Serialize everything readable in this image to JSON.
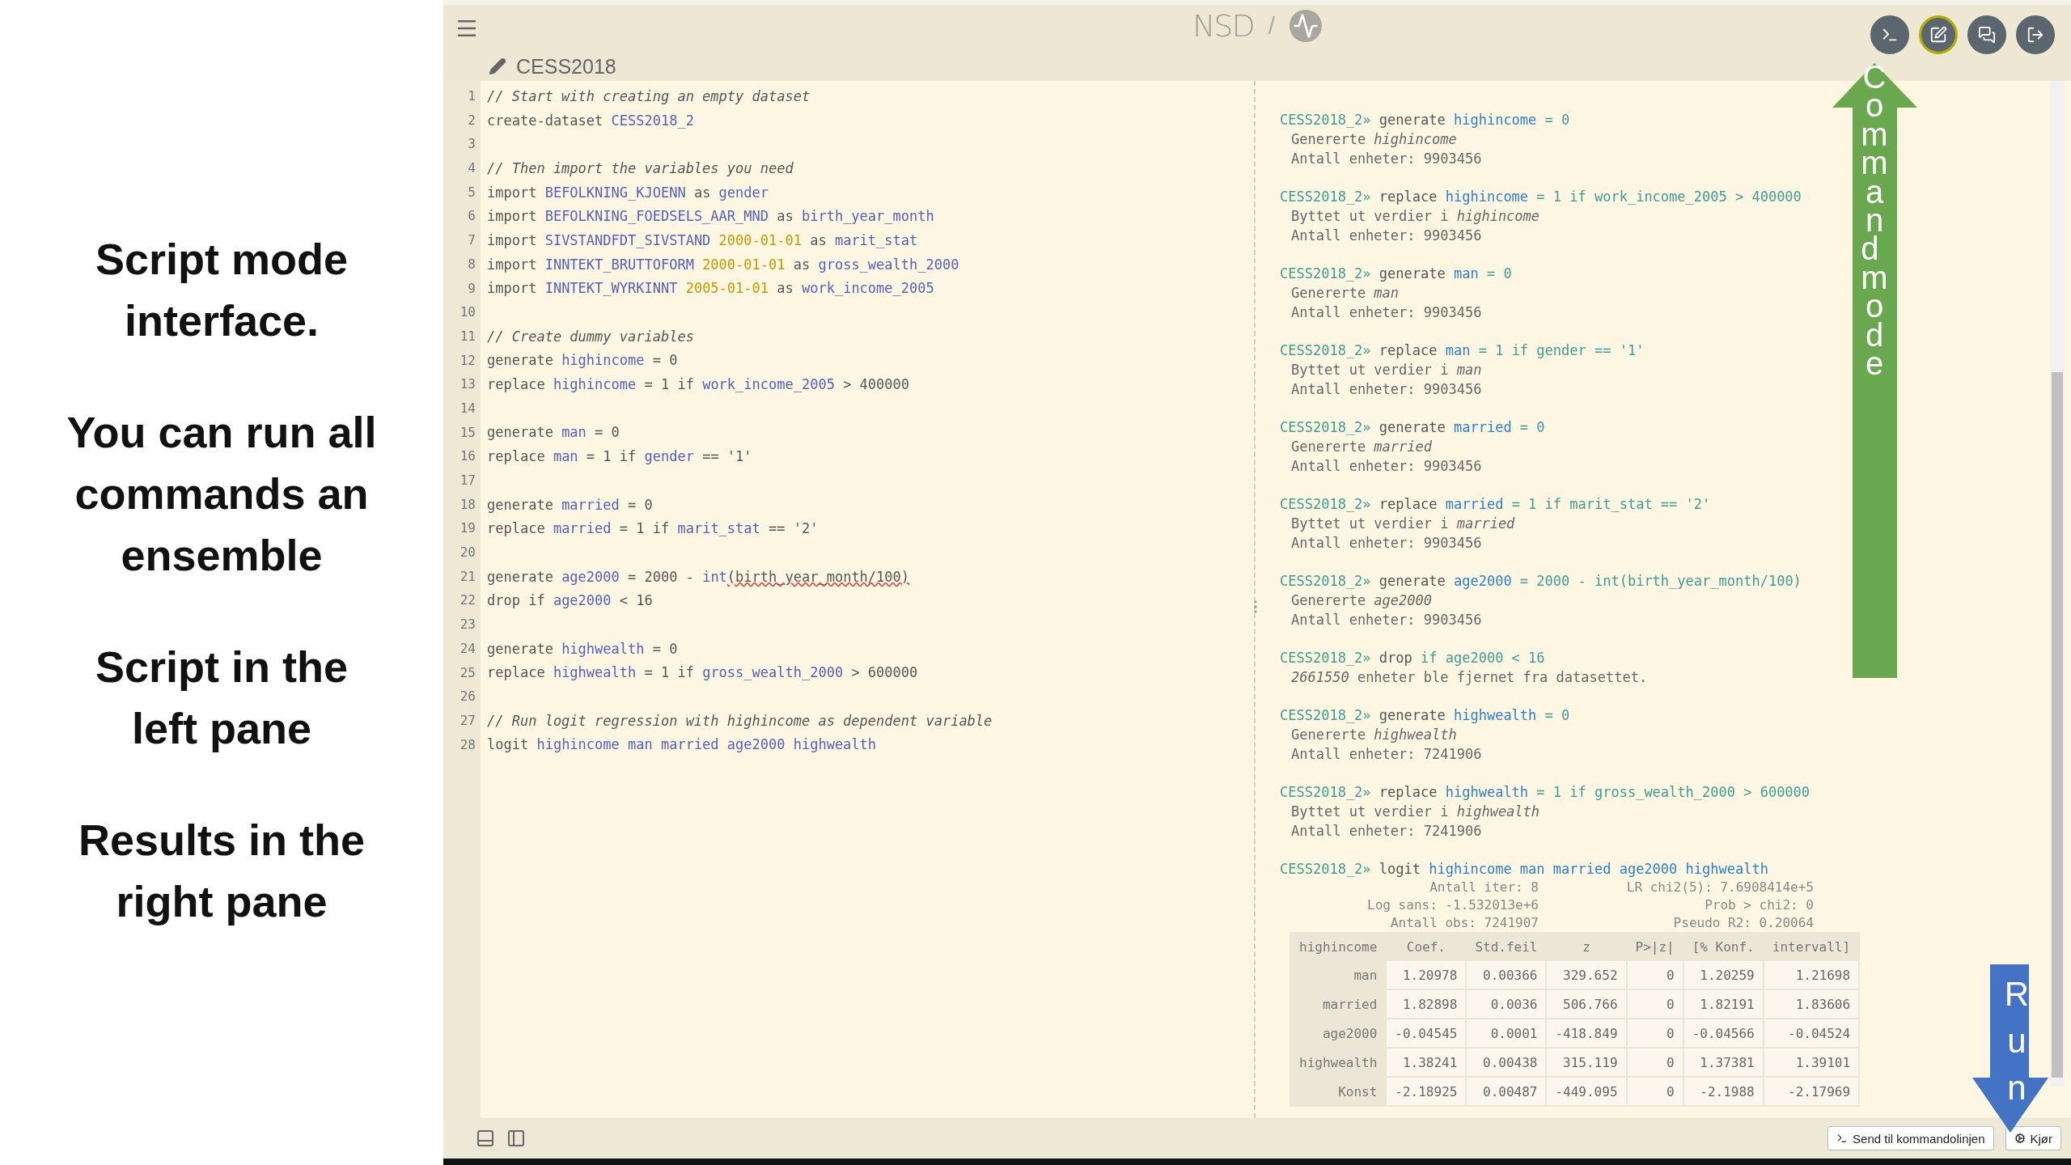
{
  "slide_captions": [
    {
      "text": "Script mode interface."
    },
    {
      "text": "You can run all commands an ensemble"
    },
    {
      "text": "Script in the left pane"
    },
    {
      "text": "Results in the right pane"
    }
  ],
  "header": {
    "logo": "NSD",
    "separator": "/",
    "mode_buttons": [
      {
        "kind": "terminal",
        "selected": false
      },
      {
        "kind": "edit",
        "selected": true
      },
      {
        "kind": "chat",
        "selected": false
      },
      {
        "kind": "logout",
        "selected": false
      }
    ]
  },
  "script_title": "CESS2018",
  "editor": {
    "lines": [
      {
        "number": "1",
        "tokens": [
          {
            "text": "// Start with creating an empty dataset",
            "kind": "comment"
          }
        ]
      },
      {
        "number": "2",
        "tokens": [
          {
            "text": "create-dataset ",
            "kind": "plain"
          },
          {
            "text": "CESS2018_2",
            "kind": "var"
          }
        ]
      },
      {
        "number": "3"
      },
      {
        "number": "4",
        "tokens": [
          {
            "text": "// Then import the variables you need",
            "kind": "comment"
          }
        ]
      },
      {
        "number": "5",
        "tokens": [
          {
            "text": "import ",
            "kind": "plain"
          },
          {
            "text": "BEFOLKNING_KJOENN",
            "kind": "var"
          },
          {
            "text": " as ",
            "kind": "plain"
          },
          {
            "text": "gender",
            "kind": "var"
          }
        ]
      },
      {
        "number": "6",
        "tokens": [
          {
            "text": "import ",
            "kind": "plain"
          },
          {
            "text": "BEFOLKNING_FOEDSELS_AAR_MND",
            "kind": "var"
          },
          {
            "text": " as ",
            "kind": "plain"
          },
          {
            "text": "birth_year_month",
            "kind": "var"
          }
        ]
      },
      {
        "number": "7",
        "tokens": [
          {
            "text": "import ",
            "kind": "plain"
          },
          {
            "text": "SIVSTANDFDT_SIVSTAND ",
            "kind": "var"
          },
          {
            "text": "2000-01-01",
            "kind": "date"
          },
          {
            "text": " as ",
            "kind": "plain"
          },
          {
            "text": "marit_stat",
            "kind": "var"
          }
        ]
      },
      {
        "number": "8",
        "tokens": [
          {
            "text": "import ",
            "kind": "plain"
          },
          {
            "text": "INNTEKT_BRUTTOFORM ",
            "kind": "var"
          },
          {
            "text": "2000-01-01",
            "kind": "date"
          },
          {
            "text": " as ",
            "kind": "plain"
          },
          {
            "text": "gross_wealth_2000",
            "kind": "var"
          }
        ]
      },
      {
        "number": "9",
        "tokens": [
          {
            "text": "import ",
            "kind": "plain"
          },
          {
            "text": "INNTEKT_WYRKINNT ",
            "kind": "var"
          },
          {
            "text": "2005-01-01",
            "kind": "date"
          },
          {
            "text": " as ",
            "kind": "plain"
          },
          {
            "text": "work_income_2005",
            "kind": "var"
          }
        ]
      },
      {
        "number": "10"
      },
      {
        "number": "11",
        "tokens": [
          {
            "text": "// Create dummy variables",
            "kind": "comment"
          }
        ]
      },
      {
        "number": "12",
        "tokens": [
          {
            "text": "generate ",
            "kind": "plain"
          },
          {
            "text": "highincome",
            "kind": "var"
          },
          {
            "text": " = 0",
            "kind": "plain"
          }
        ]
      },
      {
        "number": "13",
        "tokens": [
          {
            "text": "replace ",
            "kind": "plain"
          },
          {
            "text": "highincome",
            "kind": "var"
          },
          {
            "text": " = 1 if ",
            "kind": "plain"
          },
          {
            "text": "work_income_2005",
            "kind": "var"
          },
          {
            "text": " > 400000",
            "kind": "plain"
          }
        ]
      },
      {
        "number": "14"
      },
      {
        "number": "15",
        "tokens": [
          {
            "text": "generate ",
            "kind": "plain"
          },
          {
            "text": "man",
            "kind": "var"
          },
          {
            "text": " = 0",
            "kind": "plain"
          }
        ]
      },
      {
        "number": "16",
        "tokens": [
          {
            "text": "replace ",
            "kind": "plain"
          },
          {
            "text": "man",
            "kind": "var"
          },
          {
            "text": " = 1 if ",
            "kind": "plain"
          },
          {
            "text": "gender",
            "kind": "var"
          },
          {
            "text": " == '1'",
            "kind": "plain"
          }
        ]
      },
      {
        "number": "17"
      },
      {
        "number": "18",
        "tokens": [
          {
            "text": "generate ",
            "kind": "plain"
          },
          {
            "text": "married",
            "kind": "var"
          },
          {
            "text": " = 0",
            "kind": "plain"
          }
        ]
      },
      {
        "number": "19",
        "tokens": [
          {
            "text": "replace ",
            "kind": "plain"
          },
          {
            "text": "married",
            "kind": "var"
          },
          {
            "text": " = 1 if ",
            "kind": "plain"
          },
          {
            "text": "marit_stat",
            "kind": "var"
          },
          {
            "text": " == '2'",
            "kind": "plain"
          }
        ]
      },
      {
        "number": "20"
      },
      {
        "number": "21",
        "tokens": [
          {
            "text": "generate ",
            "kind": "plain"
          },
          {
            "text": "age2000",
            "kind": "var"
          },
          {
            "text": " = 2000 - ",
            "kind": "plain"
          },
          {
            "text": "int",
            "kind": "var"
          },
          {
            "text": "(birth_year_month/100)",
            "kind": "error"
          }
        ]
      },
      {
        "number": "22",
        "tokens": [
          {
            "text": "drop if ",
            "kind": "plain"
          },
          {
            "text": "age2000",
            "kind": "var"
          },
          {
            "text": " < 16",
            "kind": "plain"
          }
        ]
      },
      {
        "number": "23"
      },
      {
        "number": "24",
        "tokens": [
          {
            "text": "generate ",
            "kind": "plain"
          },
          {
            "text": "highwealth",
            "kind": "var"
          },
          {
            "text": " = 0",
            "kind": "plain"
          }
        ]
      },
      {
        "number": "25",
        "tokens": [
          {
            "text": "replace ",
            "kind": "plain"
          },
          {
            "text": "highwealth",
            "kind": "var"
          },
          {
            "text": " = 1 if ",
            "kind": "plain"
          },
          {
            "text": "gross_wealth_2000",
            "kind": "var"
          },
          {
            "text": " > 600000",
            "kind": "plain"
          }
        ]
      },
      {
        "number": "26"
      },
      {
        "number": "27",
        "tokens": [
          {
            "text": "// Run logit regression with highincome as dependent variable",
            "kind": "comment"
          }
        ]
      },
      {
        "number": "28",
        "tokens": [
          {
            "text": "logit ",
            "kind": "plain"
          },
          {
            "text": "highincome man married age2000 highwealth",
            "kind": "var"
          }
        ]
      }
    ]
  },
  "output": {
    "blocks": [
      {
        "prompt": "CESS2018_2»",
        "command": [
          {
            "text": "generate ",
            "kind": "plain"
          },
          {
            "text": "highincome",
            "kind": "var"
          },
          {
            "text": " = 0",
            "kind": "expr"
          }
        ],
        "messages": [
          "Genererte *highincome*",
          "Antall enheter: 9903456"
        ]
      },
      {
        "prompt": "CESS2018_2»",
        "command": [
          {
            "text": "replace ",
            "kind": "plain"
          },
          {
            "text": "highincome",
            "kind": "var"
          },
          {
            "text": " = 1 if work_income_2005 > 400000",
            "kind": "expr"
          }
        ],
        "messages": [
          "Byttet ut verdier i *highincome*",
          "Antall enheter: 9903456"
        ]
      },
      {
        "prompt": "CESS2018_2»",
        "command": [
          {
            "text": "generate ",
            "kind": "plain"
          },
          {
            "text": "man",
            "kind": "var"
          },
          {
            "text": " = 0",
            "kind": "expr"
          }
        ],
        "messages": [
          "Genererte *man*",
          "Antall enheter: 9903456"
        ]
      },
      {
        "prompt": "CESS2018_2»",
        "command": [
          {
            "text": "replace ",
            "kind": "plain"
          },
          {
            "text": "man",
            "kind": "var"
          },
          {
            "text": " = 1 if gender == '1'",
            "kind": "expr"
          }
        ],
        "messages": [
          "Byttet ut verdier i *man*",
          "Antall enheter: 9903456"
        ]
      },
      {
        "prompt": "CESS2018_2»",
        "command": [
          {
            "text": "generate ",
            "kind": "plain"
          },
          {
            "text": "married",
            "kind": "var"
          },
          {
            "text": " = 0",
            "kind": "expr"
          }
        ],
        "messages": [
          "Genererte *married*",
          "Antall enheter: 9903456"
        ]
      },
      {
        "prompt": "CESS2018_2»",
        "command": [
          {
            "text": "replace ",
            "kind": "plain"
          },
          {
            "text": "married",
            "kind": "var"
          },
          {
            "text": " = 1 if marit_stat == '2'",
            "kind": "expr"
          }
        ],
        "messages": [
          "Byttet ut verdier i *married*",
          "Antall enheter: 9903456"
        ]
      },
      {
        "prompt": "CESS2018_2»",
        "command": [
          {
            "text": "generate ",
            "kind": "plain"
          },
          {
            "text": "age2000",
            "kind": "var"
          },
          {
            "text": " = 2000 - int(birth_year_month/100)",
            "kind": "expr"
          }
        ],
        "messages": [
          "Genererte *age2000*",
          "Antall enheter: 9903456"
        ]
      },
      {
        "prompt": "CESS2018_2»",
        "command": [
          {
            "text": "drop ",
            "kind": "plain"
          },
          {
            "text": "if age2000 < 16",
            "kind": "expr"
          }
        ],
        "messages": [
          "*2661550* enheter ble fjernet fra datasettet."
        ]
      },
      {
        "prompt": "CESS2018_2»",
        "command": [
          {
            "text": "generate ",
            "kind": "plain"
          },
          {
            "text": "highwealth",
            "kind": "var"
          },
          {
            "text": " = 0",
            "kind": "expr"
          }
        ],
        "messages": [
          "Genererte *highwealth*",
          "Antall enheter: 7241906"
        ]
      },
      {
        "prompt": "CESS2018_2»",
        "command": [
          {
            "text": "replace ",
            "kind": "plain"
          },
          {
            "text": "highwealth",
            "kind": "var"
          },
          {
            "text": " = 1 if gross_wealth_2000 > 600000",
            "kind": "expr"
          }
        ],
        "messages": [
          "Byttet ut verdier i *highwealth*",
          "Antall enheter: 7241906"
        ]
      },
      {
        "prompt": "CESS2018_2»",
        "command": [
          {
            "text": "logit ",
            "kind": "plain"
          },
          {
            "text": "highincome man married age2000 highwealth",
            "kind": "var"
          }
        ],
        "stats": [
          [
            "Antall iter: 8",
            "LR chi2(5): 7.6908414e+5"
          ],
          [
            "Log sans: -1.532013e+6",
            "Prob > chi2: 0"
          ],
          [
            "Antall obs: 7241907",
            "Pseudo R2: 0.20064"
          ]
        ],
        "table": {
          "columns": [
            "highincome",
            "Coef.",
            "Std.feil",
            "z",
            "P>|z|",
            "[% Konf.",
            "intervall]"
          ],
          "rows": [
            [
              "man",
              "1.20978",
              "0.00366",
              "329.652",
              "0",
              "1.20259",
              "1.21698"
            ],
            [
              "married",
              "1.82898",
              "0.0036",
              "506.766",
              "0",
              "1.82191",
              "1.83606"
            ],
            [
              "age2000",
              "-0.04545",
              "0.0001",
              "-418.849",
              "0",
              "-0.04566",
              "-0.04524"
            ],
            [
              "highwealth",
              "1.38241",
              "0.00438",
              "315.119",
              "0",
              "1.37381",
              "1.39101"
            ],
            [
              "Konst",
              "-2.18925",
              "0.00487",
              "-449.095",
              "0",
              "-2.1988",
              "-2.17969"
            ]
          ]
        }
      }
    ]
  },
  "footer": {
    "send_button": "Send til kommandolinjen",
    "run_button": "Kjør"
  },
  "annotations": [
    {
      "kind": "up",
      "label": "Command mode",
      "color": "#6aa84f"
    },
    {
      "kind": "down",
      "label": "Run",
      "color": "#4472c4"
    }
  ]
}
